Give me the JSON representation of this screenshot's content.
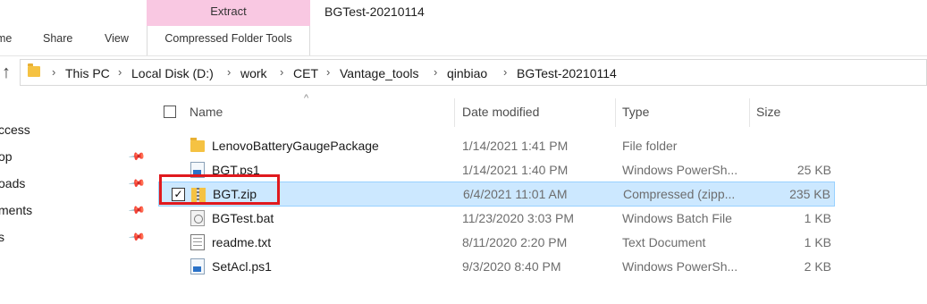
{
  "ribbon": {
    "context_group": "Extract",
    "window_title": "BGTest-20210114",
    "tabs": {
      "home": "me",
      "share": "Share",
      "view": "View",
      "compressed": "Compressed Folder Tools"
    }
  },
  "address": {
    "breadcrumbs": [
      "This PC",
      "Local Disk (D:)",
      "work",
      "CET",
      "Vantage_tools",
      "qinbiao",
      "BGTest-20210114"
    ]
  },
  "nav": {
    "items": [
      "ccess",
      "op",
      "oads",
      "ments",
      "s"
    ]
  },
  "columns": {
    "name": "Name",
    "date": "Date modified",
    "type": "Type",
    "size": "Size"
  },
  "files": [
    {
      "name": "LenovoBatteryGaugePackage",
      "date": "1/14/2021 1:41 PM",
      "type": "File folder",
      "size": "",
      "icon": "folder-icon"
    },
    {
      "name": "BGT.ps1",
      "date": "1/14/2021 1:40 PM",
      "type": "Windows PowerSh...",
      "size": "25 KB",
      "icon": "powershell-file-icon"
    },
    {
      "name": "BGT.zip",
      "date": "6/4/2021 11:01 AM",
      "type": "Compressed (zipp...",
      "size": "235 KB",
      "icon": "zip-folder-icon",
      "selected": true,
      "check": "✓"
    },
    {
      "name": "BGTest.bat",
      "date": "11/23/2020 3:03 PM",
      "type": "Windows Batch File",
      "size": "1 KB",
      "icon": "batch-file-icon"
    },
    {
      "name": "readme.txt",
      "date": "8/11/2020 2:20 PM",
      "type": "Text Document",
      "size": "1 KB",
      "icon": "text-file-icon"
    },
    {
      "name": "SetAcl.ps1",
      "date": "9/3/2020 8:40 PM",
      "type": "Windows PowerSh...",
      "size": "2 KB",
      "icon": "powershell-file-icon"
    }
  ],
  "colors": {
    "selection": "#cce8ff",
    "context_band": "#f9c8e2",
    "annotation": "#e0191e"
  },
  "glyphs": {
    "up_arrow": "↑",
    "separator": "›",
    "sort_caret": "^",
    "pin": "📌"
  }
}
